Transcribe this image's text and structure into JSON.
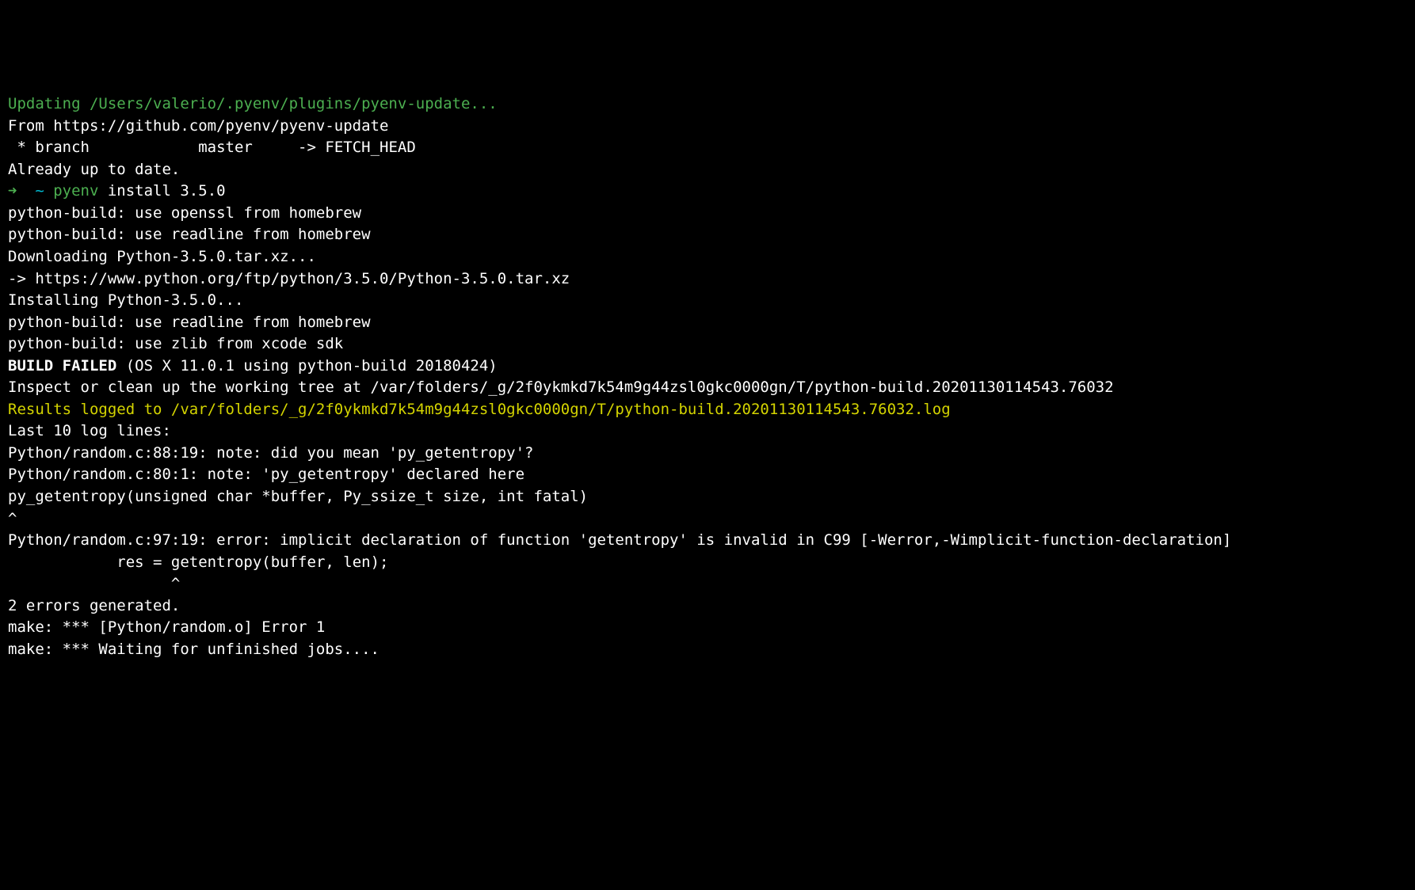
{
  "terminal": {
    "updating_line": "Updating /Users/valerio/.pyenv/plugins/pyenv-update...",
    "from_line": "From https://github.com/pyenv/pyenv-update",
    "branch_line": " * branch            master     -> FETCH_HEAD",
    "already_up": "Already up to date.",
    "prompt_arrow": "➜  ",
    "prompt_tilde": "~ ",
    "prompt_cmd": "pyenv",
    "prompt_args": " install 3.5.0",
    "openssl_line": "python-build: use openssl from homebrew",
    "readline_line1": "python-build: use readline from homebrew",
    "downloading_line": "Downloading Python-3.5.0.tar.xz...",
    "url_line": "-> https://www.python.org/ftp/python/3.5.0/Python-3.5.0.tar.xz",
    "installing_line": "Installing Python-3.5.0...",
    "readline_line2": "python-build: use readline from homebrew",
    "zlib_line": "python-build: use zlib from xcode sdk",
    "blank": "",
    "build_failed_bold": "BUILD FAILED",
    "build_failed_rest": " (OS X 11.0.1 using python-build 20180424)",
    "inspect_line": "Inspect or clean up the working tree at /var/folders/_g/2f0ykmkd7k54m9g44zsl0gkc0000gn/T/python-build.20201130114543.76032",
    "results_line": "Results logged to /var/folders/_g/2f0ykmkd7k54m9g44zsl0gkc0000gn/T/python-build.20201130114543.76032.log",
    "last10_line": "Last 10 log lines:",
    "note1_line": "Python/random.c:88:19: note: did you mean 'py_getentropy'?",
    "note2_line": "Python/random.c:80:1: note: 'py_getentropy' declared here",
    "decl_line": "py_getentropy(unsigned char *buffer, Py_ssize_t size, int fatal)",
    "caret1": "^",
    "error_line": "Python/random.c:97:19: error: implicit declaration of function 'getentropy' is invalid in C99 [-Werror,-Wimplicit-function-declaration]",
    "res_line": "            res = getentropy(buffer, len);",
    "caret2": "                  ^",
    "errors_gen": "2 errors generated.",
    "make_error": "make: *** [Python/random.o] Error 1",
    "make_waiting": "make: *** Waiting for unfinished jobs...."
  }
}
